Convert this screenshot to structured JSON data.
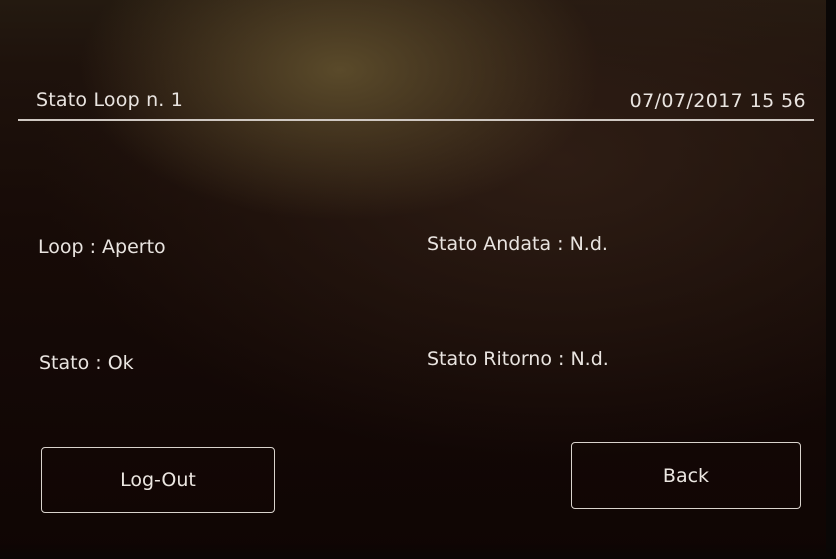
{
  "header": {
    "title": "Stato Loop n. 1",
    "datetime": "07/07/2017 15 56"
  },
  "status": {
    "loop": "Loop : Aperto",
    "stato": "Stato : Ok",
    "andata": "Stato Andata : N.d.",
    "ritorno": "Stato Ritorno : N.d."
  },
  "buttons": {
    "logout_label": "Log-Out",
    "back_label": "Back"
  },
  "colors": {
    "screen_background": "#170b07",
    "text": "#e9e4e0",
    "outline": "#d9d3cd"
  }
}
